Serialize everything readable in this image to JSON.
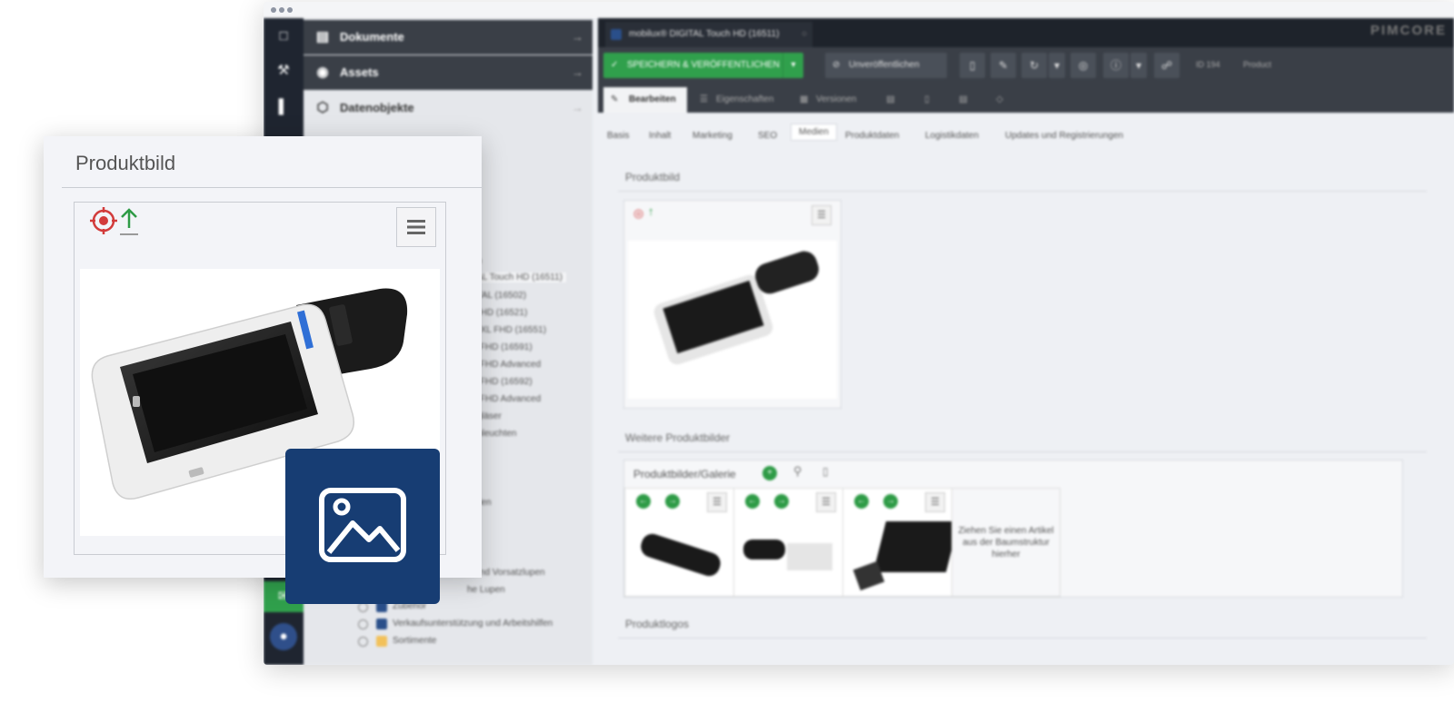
{
  "app": {
    "left_panel": {
      "accordions": [
        {
          "label": "Dokumente",
          "icon": "document-icon"
        },
        {
          "label": "Assets",
          "icon": "camera-icon"
        },
        {
          "label": "Datenobjekte",
          "icon": "cube-icon"
        }
      ],
      "tree_items": [
        "lfen",
        "ITAL Touch HD (16511)",
        "GITAL (16502)",
        "AL HD (16521)",
        "AL XL FHD (16551)",
        "16 FHD (16591)",
        "16 FHD Advanced",
        "22 FHD (16592)",
        "22 FHD Advanced",
        "segläser",
        "penleuchten",
        "brillen",
        "n und Vorsatzlupen",
        "he Lupen",
        "Zubehör",
        "Verkaufsunterstützung und Arbeitshilfen",
        "Sortimente"
      ]
    },
    "tab": {
      "label": "mobilux® DIGITAL Touch HD (16511)"
    },
    "logo": "PIMCORE",
    "toolbar": {
      "save_label": "SPEICHERN & VERÖFFENTLICHEN",
      "unpublish_label": "Unveröffentlichen",
      "id_label": "ID 194",
      "type_label": "Product"
    },
    "edit_tabs": [
      {
        "label": "Bearbeiten"
      },
      {
        "label": "Eigenschaften"
      },
      {
        "label": "Versionen"
      }
    ],
    "sub_tabs": [
      "Basis",
      "Inhalt",
      "Marketing",
      "SEO",
      "Medien",
      "Produktdaten",
      "Logistikdaten",
      "Updates und Registrierungen"
    ],
    "sections": {
      "produktbild": "Produktbild",
      "weitere": "Weitere Produktbilder",
      "gallery_label": "Produktbilder/Galerie",
      "drop_hint": "Ziehen Sie einen Artikel aus der Baumstruktur hierher",
      "logos": "Produktlogos"
    }
  },
  "popup": {
    "title": "Produktbild"
  },
  "colors": {
    "green": "#30a04c",
    "dark_toolbar": "#3a3f47",
    "badge_blue": "#173d73",
    "target_red": "#d23b3b",
    "upload_green": "#2e9b46"
  }
}
